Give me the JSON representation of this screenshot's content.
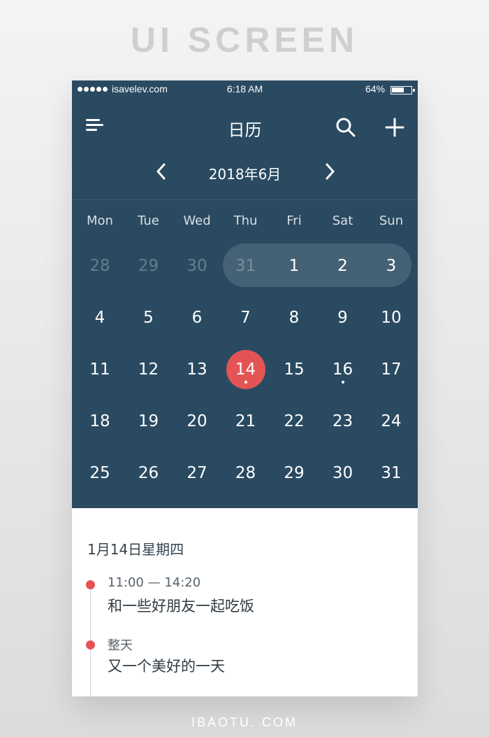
{
  "page_heading": "UI SCREEN",
  "footer_brand": "IBAOTU. COM",
  "status_bar": {
    "carrier": "isavelev.com",
    "time": "6:18 AM",
    "battery_percent": "64%",
    "battery_level": 0.64
  },
  "header": {
    "title": "日历",
    "menu_icon": "menu-icon",
    "search_icon": "search-icon",
    "add_icon": "plus-icon"
  },
  "month_nav": {
    "label": "2018年6月",
    "prev_icon": "chevron-left-icon",
    "next_icon": "chevron-right-icon"
  },
  "calendar": {
    "weekdays": [
      "Mon",
      "Tue",
      "Wed",
      "Thu",
      "Fri",
      "Sat",
      "Sun"
    ],
    "weeks": [
      [
        "28",
        "29",
        "30",
        "31",
        "1",
        "2",
        "3"
      ],
      [
        "4",
        "5",
        "6",
        "7",
        "8",
        "9",
        "10"
      ],
      [
        "11",
        "12",
        "13",
        "14",
        "15",
        "16",
        "17"
      ],
      [
        "18",
        "19",
        "20",
        "21",
        "22",
        "23",
        "24"
      ],
      [
        "25",
        "26",
        "27",
        "28",
        "29",
        "30",
        "31"
      ]
    ],
    "muted_days": [
      "28",
      "29",
      "30",
      "31"
    ],
    "selected_day": "14",
    "event_days": [
      "14",
      "16"
    ]
  },
  "agenda": {
    "date": "1月14日星期四",
    "events": [
      {
        "time": "11:00 — 14:20",
        "title": "和一些好朋友一起吃饭"
      },
      {
        "time": "整天",
        "title": "又一个美好的一天"
      }
    ]
  },
  "colors": {
    "panel": "#2a4a61",
    "accent": "#e45454",
    "agenda_background": "#ffffff"
  }
}
